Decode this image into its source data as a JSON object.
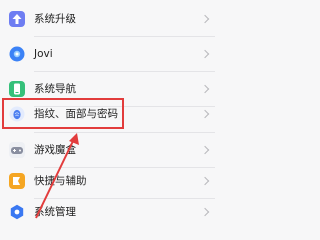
{
  "settings_list": {
    "items": [
      {
        "label": "系统升级",
        "icon": "arrow-up-icon",
        "color": "#6e7df2"
      },
      {
        "label": "Jovi",
        "icon": "jovi-icon",
        "color": "#3b82f6"
      },
      {
        "label": "系统导航",
        "icon": "phone-navigation-icon",
        "color": "#35c07a"
      },
      {
        "label": "指纹、面部与密码",
        "icon": "fingerprint-icon",
        "color": "#4a7df0"
      },
      {
        "label": "游戏魔盒",
        "icon": "game-box-icon",
        "color": "#8a8fa0"
      },
      {
        "label": "快捷与辅助",
        "icon": "shortcut-icon",
        "color": "#f5a623"
      },
      {
        "label": "系统管理",
        "icon": "gear-icon",
        "color": "#3a78f2"
      }
    ]
  },
  "annotation": {
    "highlight_color": "#e23c3c"
  }
}
